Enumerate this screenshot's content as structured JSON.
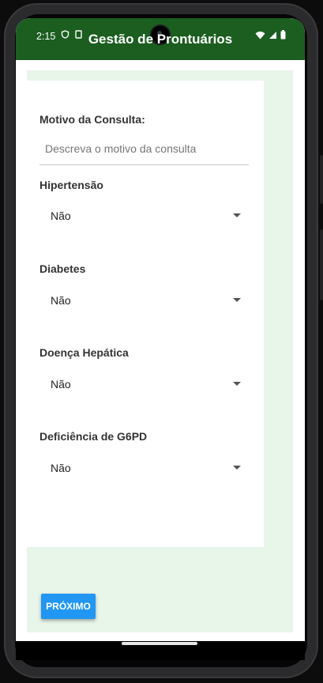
{
  "status_bar": {
    "time": "2:15"
  },
  "app_bar": {
    "title": "Gestão de Prontuários"
  },
  "form": {
    "motivo": {
      "label": "Motivo da Consulta:",
      "placeholder": "Descreva o motivo da consulta",
      "value": ""
    },
    "hipertensao": {
      "label": "Hipertensão",
      "value": "Não"
    },
    "diabetes": {
      "label": "Diabetes",
      "value": "Não"
    },
    "doenca_hepatica": {
      "label": "Doença Hepática",
      "value": "Não"
    },
    "deficiencia_g6pd": {
      "label": "Deficiência de G6PD",
      "value": "Não"
    }
  },
  "actions": {
    "next_label": "PRÓXIMO"
  },
  "colors": {
    "app_bar": "#1b5e20",
    "background": "#e8f5e9",
    "button": "#2196f3"
  },
  "icons": [
    "vpn-key-icon",
    "sim-icon",
    "wifi-icon",
    "signal-icon",
    "battery-icon",
    "dropdown-caret-icon"
  ]
}
